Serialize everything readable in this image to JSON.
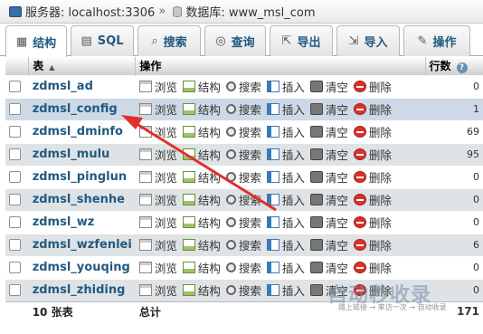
{
  "breadcrumb": {
    "server": "服务器: localhost:3306",
    "separator": "»",
    "database": "数据库: www_msl_com"
  },
  "tabs": [
    {
      "label": "结构",
      "icon": "structure-icon"
    },
    {
      "label": "SQL",
      "icon": "sql-icon"
    },
    {
      "label": "搜索",
      "icon": "search-icon"
    },
    {
      "label": "查询",
      "icon": "query-icon"
    },
    {
      "label": "导出",
      "icon": "export-icon"
    },
    {
      "label": "导入",
      "icon": "import-icon"
    },
    {
      "label": "操作",
      "icon": "wrench-icon"
    }
  ],
  "table": {
    "headers": {
      "table": "表",
      "sort_indicator": "▲",
      "actions": "操作",
      "rows": "行数",
      "help": "?"
    },
    "action_labels": {
      "browse": "浏览",
      "structure": "结构",
      "search": "搜索",
      "insert": "插入",
      "empty": "清空",
      "drop": "删除"
    },
    "rows": [
      {
        "name": "zdmsl_ad",
        "rows": "0"
      },
      {
        "name": "zdmsl_config",
        "rows": "1"
      },
      {
        "name": "zdmsl_dminfo",
        "rows": "69"
      },
      {
        "name": "zdmsl_mulu",
        "rows": "95"
      },
      {
        "name": "zdmsl_pinglun",
        "rows": "0"
      },
      {
        "name": "zdmsl_shenhe",
        "rows": "0"
      },
      {
        "name": "zdmsl_wz",
        "rows": "0"
      },
      {
        "name": "zdmsl_wzfenlei",
        "rows": "6"
      },
      {
        "name": "zdmsl_youqing",
        "rows": "0"
      },
      {
        "name": "zdmsl_zhiding",
        "rows": "0"
      }
    ],
    "footer": {
      "count": "10 张表",
      "total_label": "总计",
      "total_rows": "171"
    }
  },
  "watermark": {
    "main": "自动秒收录",
    "sub": "路上链接 → 来访一次 → 自动收录"
  },
  "colors": {
    "link": "#235a81",
    "arrow": "#e0312a",
    "highlight_row": "#cdd9e6"
  }
}
